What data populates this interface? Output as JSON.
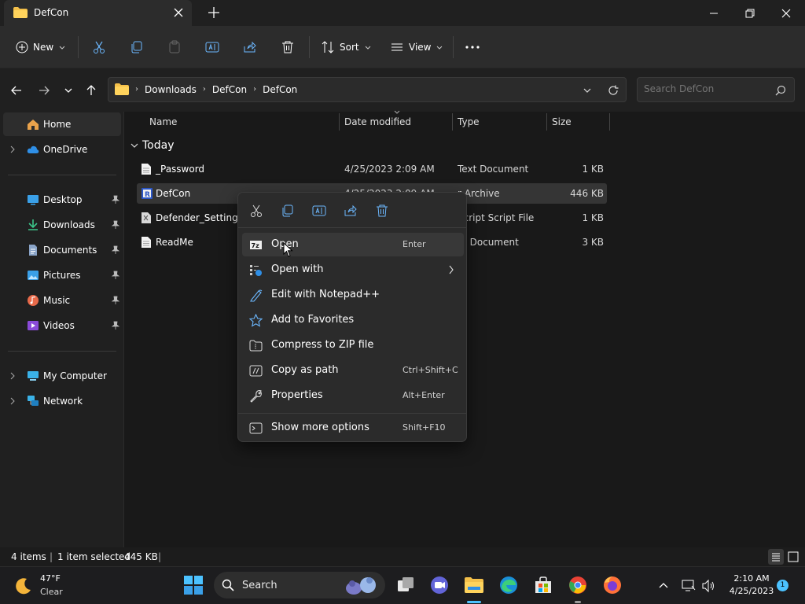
{
  "window": {
    "tab_title": "DefCon",
    "accent_color": "#4cc2ff",
    "folder_color": "#f4c04a"
  },
  "toolbar": {
    "new_label": "New",
    "sort_label": "Sort",
    "view_label": "View"
  },
  "address": {
    "crumbs": [
      "Downloads",
      "DefCon",
      "DefCon"
    ],
    "search_placeholder": "Search DefCon"
  },
  "sidebar": {
    "items": [
      {
        "label": "Home"
      },
      {
        "label": "OneDrive"
      },
      {
        "label": "Desktop"
      },
      {
        "label": "Downloads"
      },
      {
        "label": "Documents"
      },
      {
        "label": "Pictures"
      },
      {
        "label": "Music"
      },
      {
        "label": "Videos"
      },
      {
        "label": "My Computer"
      },
      {
        "label": "Network"
      }
    ]
  },
  "filelist": {
    "columns": [
      "Name",
      "Date modified",
      "Type",
      "Size"
    ],
    "group": "Today",
    "rows": [
      {
        "name": "_Password",
        "date": "4/25/2023 2:09 AM",
        "type": "Text Document",
        "size": "1 KB"
      },
      {
        "name": "DefCon",
        "date": "4/25/2023 2:09 AM",
        "type": "r Archive",
        "size": "446 KB"
      },
      {
        "name": "Defender_Settings",
        "date": "",
        "type": "Script Script File",
        "size": "1 KB"
      },
      {
        "name": "ReadMe",
        "date": "",
        "type": "xt Document",
        "size": "3 KB"
      }
    ]
  },
  "context_menu": {
    "items": [
      {
        "label": "Open",
        "key": "Enter"
      },
      {
        "label": "Open with",
        "key": ""
      },
      {
        "label": "Edit with Notepad++",
        "key": ""
      },
      {
        "label": "Add to Favorites",
        "key": ""
      },
      {
        "label": "Compress to ZIP file",
        "key": ""
      },
      {
        "label": "Copy as path",
        "key": "Ctrl+Shift+C"
      },
      {
        "label": "Properties",
        "key": "Alt+Enter"
      },
      {
        "label": "Show more options",
        "key": "Shift+F10"
      }
    ]
  },
  "status": {
    "count": "4 items",
    "selection": "1 item selected",
    "size": "445 KB"
  },
  "taskbar": {
    "weather_temp": "47°F",
    "weather_cond": "Clear",
    "search_label": "Search",
    "time": "2:10 AM",
    "date": "4/25/2023",
    "notifications": "1"
  }
}
